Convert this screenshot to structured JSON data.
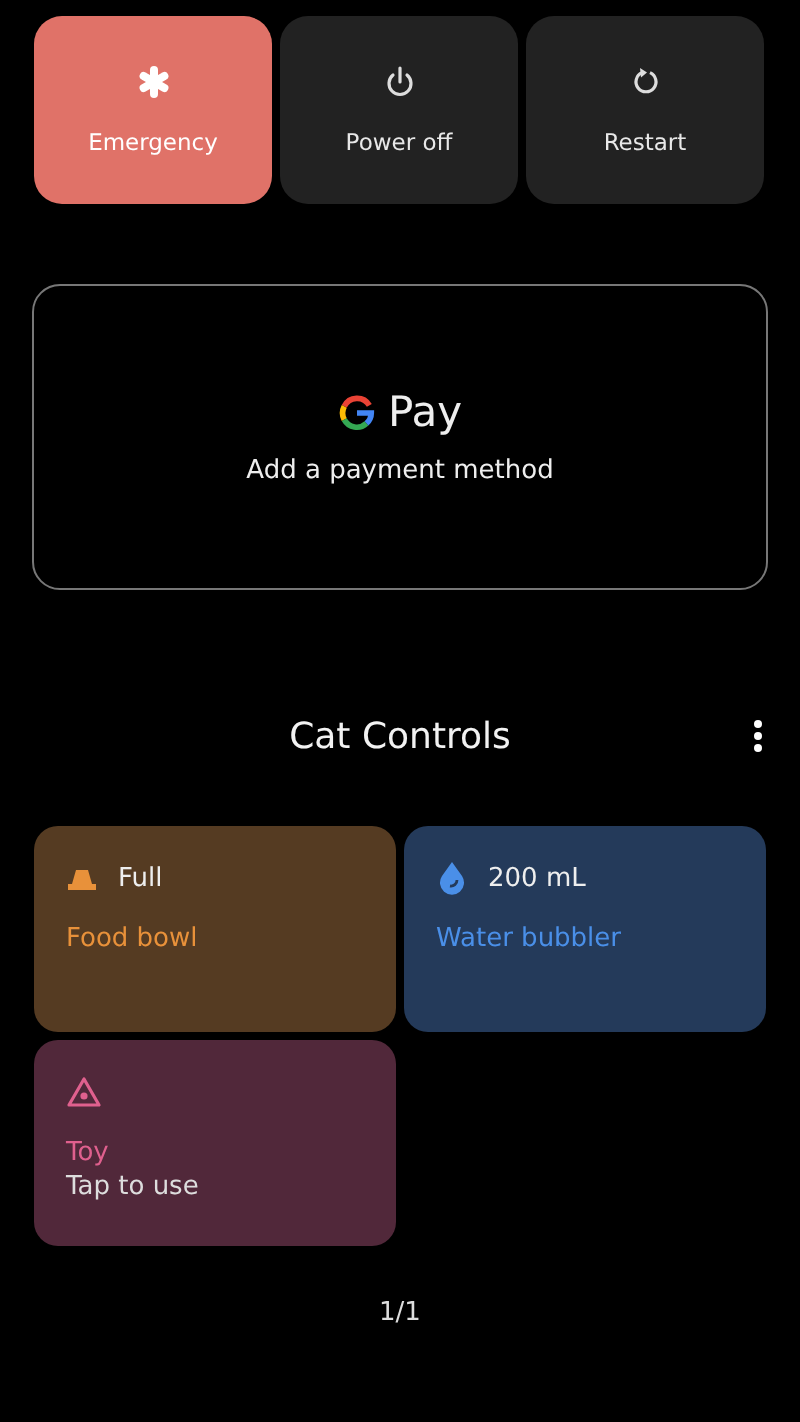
{
  "power_menu": [
    {
      "kind": "emergency",
      "label": "Emergency"
    },
    {
      "kind": "power",
      "label": "Power off"
    },
    {
      "kind": "restart",
      "label": "Restart"
    }
  ],
  "wallet": {
    "brand": "Pay",
    "subtitle": "Add a payment method"
  },
  "controls": {
    "title": "Cat Controls",
    "tiles": [
      {
        "kind": "food",
        "status": "Full",
        "label": "Food bowl",
        "color": "#e8913a"
      },
      {
        "kind": "water",
        "status": "200 mL",
        "label": "Water bubbler",
        "color": "#4a8fe8"
      },
      {
        "kind": "toy",
        "label": "Toy",
        "subtitle": "Tap to use",
        "color": "#e0608e"
      }
    ],
    "page": "1/1"
  }
}
